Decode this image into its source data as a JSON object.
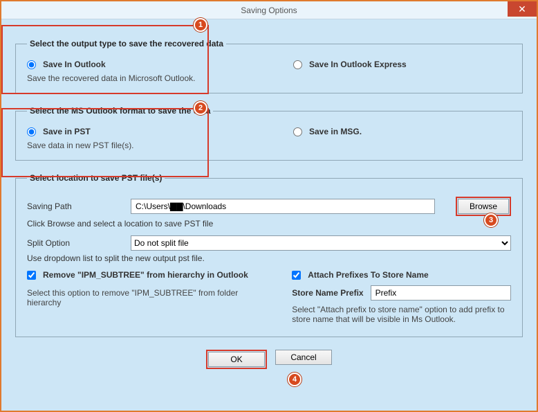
{
  "window": {
    "title": "Saving Options",
    "close_icon": "✕"
  },
  "group1": {
    "legend": "Select the output type to save the recovered data",
    "radio_outlook_label": "Save In Outlook",
    "radio_outlook_hint": "Save the recovered data in Microsoft Outlook.",
    "radio_express_label": "Save In Outlook Express"
  },
  "group2": {
    "legend": "Select the MS Outlook format to save the data",
    "radio_pst_label": "Save in PST",
    "radio_pst_hint": "Save data in new PST file(s).",
    "radio_msg_label": "Save in MSG."
  },
  "group3": {
    "legend": "Select location to save PST file(s)",
    "path_label": "Saving Path",
    "path_value": "C:\\Users\\▇▇\\Downloads",
    "browse_label": "Browse",
    "path_hint": "Click Browse and select a location to save PST file",
    "split_label": "Split Option",
    "split_value": "Do not split file",
    "split_hint": "Use dropdown list to split the new output pst file.",
    "remove_ipm_label": "Remove \"IPM_SUBTREE\" from hierarchy in Outlook",
    "remove_ipm_hint": "Select this option to remove \"IPM_SUBTREE\" from folder hierarchy",
    "attach_prefix_label": "Attach Prefixes To Store Name",
    "prefix_field_label": "Store Name Prefix",
    "prefix_value": "Prefix",
    "prefix_hint": "Select \"Attach prefix to store name\" option to add prefix to store name that will be visible in Ms Outlook."
  },
  "buttons": {
    "ok": "OK",
    "cancel": "Cancel"
  },
  "callouts": {
    "c1": "1",
    "c2": "2",
    "c3": "3",
    "c4": "4"
  }
}
